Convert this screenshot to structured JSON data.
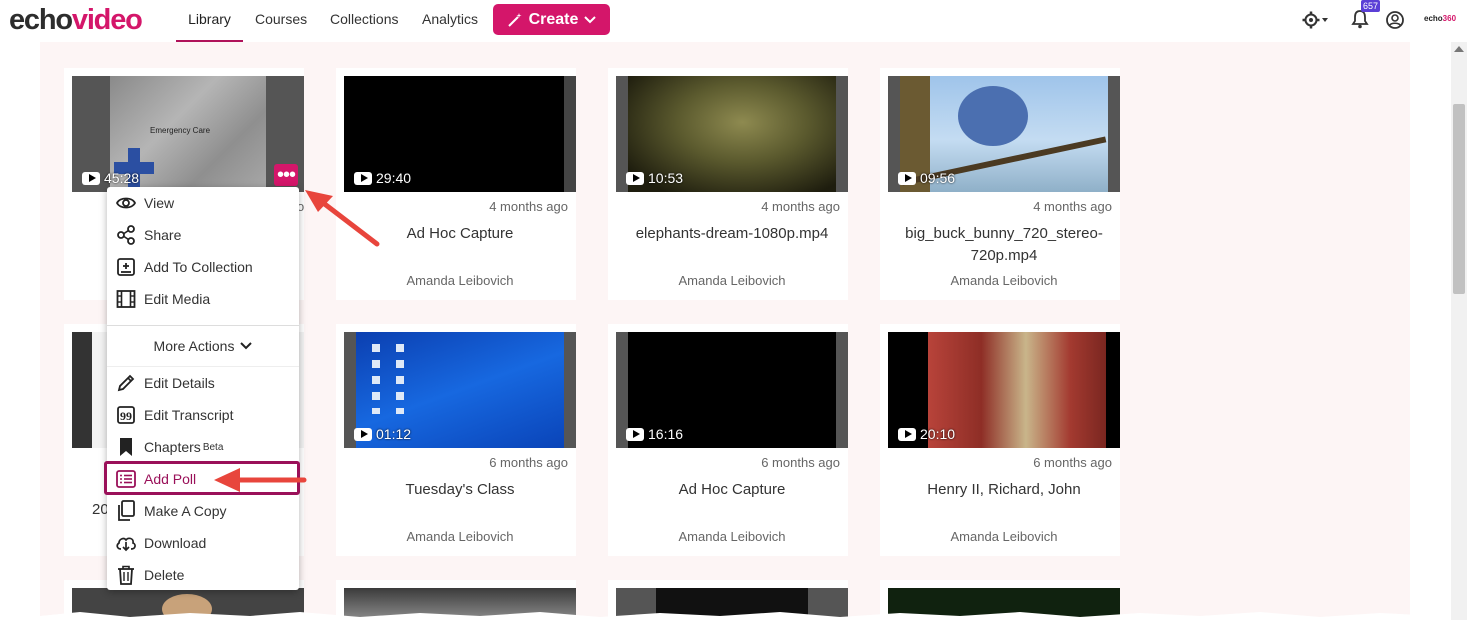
{
  "header": {
    "logo_part1": "echo",
    "logo_part2": "video",
    "nav": [
      "Library",
      "Courses",
      "Collections",
      "Analytics"
    ],
    "active_nav": "Library",
    "create_label": "Create",
    "notification_count": "657",
    "brand_small_a": "echo",
    "brand_small_b": "360"
  },
  "videos": [
    {
      "duration": "45:28",
      "age": "",
      "title": "",
      "owner": ""
    },
    {
      "duration": "29:40",
      "age": "4 months ago",
      "title": "Ad Hoc Capture",
      "owner": "Amanda Leibovich"
    },
    {
      "duration": "10:53",
      "age": "4 months ago",
      "title": "elephants-dream-1080p.mp4",
      "owner": "Amanda Leibovich"
    },
    {
      "duration": "09:56",
      "age": "4 months ago",
      "title": "big_buck_bunny_720_stereo-720p.mp4",
      "owner": "Amanda Leibovich"
    },
    {
      "duration": "",
      "age": "",
      "title": "20",
      "owner": ""
    },
    {
      "duration": "01:12",
      "age": "6 months ago",
      "title": "Tuesday's Class",
      "owner": "Amanda Leibovich"
    },
    {
      "duration": "16:16",
      "age": "6 months ago",
      "title": "Ad Hoc Capture",
      "owner": "Amanda Leibovich"
    },
    {
      "duration": "20:10",
      "age": "6 months ago",
      "title": "Henry II, Richard, John",
      "owner": "Amanda Leibovich"
    }
  ],
  "thumb_text_emergency": "Emergency Care",
  "partial_age_1": "o",
  "menu": {
    "items_top": [
      "View",
      "Share",
      "Add To Collection",
      "Edit Media"
    ],
    "more_actions": "More Actions",
    "items_bottom": [
      "Edit Details",
      "Edit Transcript",
      "Chapters",
      "Add Poll",
      "Make A Copy",
      "Download",
      "Delete"
    ],
    "beta": "Beta"
  },
  "colors": {
    "brand": "#d4166a",
    "highlight": "#9a1059",
    "arrow": "#e8453c"
  }
}
